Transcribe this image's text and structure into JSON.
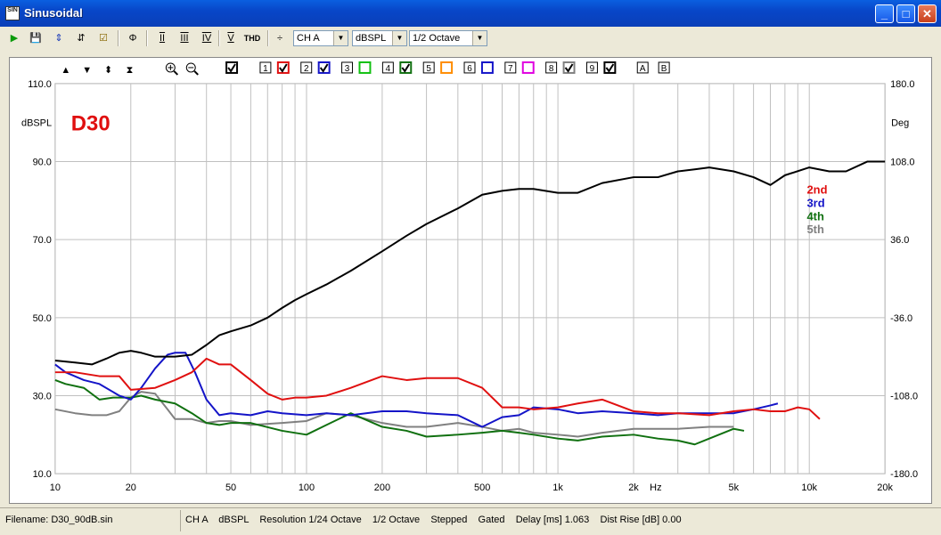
{
  "window": {
    "title": "Sinusoidal",
    "icon_text": "SIN"
  },
  "toolbar": {
    "thd_label": "THD",
    "combos": [
      {
        "value": "CH A"
      },
      {
        "value": "dBSPL"
      },
      {
        "value": "1/2 Octave"
      }
    ]
  },
  "plot": {
    "label": "D30",
    "left_unit": "dBSPL",
    "right_unit": "Deg",
    "x_unit": "Hz",
    "left_ticks": [
      "110.0",
      "90.0",
      "70.0",
      "50.0",
      "30.0",
      "10.0"
    ],
    "right_ticks": [
      "180.0",
      "108.0",
      "36.0",
      "-36.0",
      "-108.0",
      "-180.0"
    ],
    "x_ticks": [
      "10",
      "20",
      "50",
      "100",
      "200",
      "500",
      "1k",
      "2k",
      "5k",
      "10k",
      "20k"
    ],
    "legend": [
      "2nd",
      "3rd",
      "4th",
      "5th"
    ],
    "checkbox_numbers": [
      "1",
      "2",
      "3",
      "4",
      "5",
      "6",
      "7",
      "8",
      "9"
    ],
    "ab_buttons": [
      "A",
      "B"
    ]
  },
  "colors": {
    "fundamental": "#000000",
    "2nd": "#e01010",
    "3rd": "#1414c8",
    "4th": "#107010",
    "5th": "#808080",
    "label": "#e01010"
  },
  "chart_data": {
    "type": "line",
    "xscale": "log",
    "xlim": [
      10,
      20000
    ],
    "ylim": [
      10,
      110
    ],
    "xlabel": "Hz",
    "ylabel": "dBSPL",
    "series": [
      {
        "name": "fundamental",
        "x": [
          10,
          12,
          14,
          16,
          18,
          20,
          22,
          25,
          30,
          35,
          40,
          45,
          50,
          60,
          70,
          80,
          90,
          100,
          120,
          150,
          200,
          250,
          300,
          400,
          500,
          600,
          700,
          800,
          1000,
          1200,
          1500,
          2000,
          2500,
          3000,
          3500,
          4000,
          5000,
          6000,
          7000,
          8000,
          10000,
          12000,
          14000,
          17000,
          20000
        ],
        "y": [
          39,
          38.5,
          38,
          39.5,
          41,
          41.5,
          41,
          40,
          40,
          40.5,
          43,
          45.5,
          46.5,
          48,
          50,
          52.5,
          54.5,
          56,
          58.5,
          62,
          67,
          71,
          74,
          78,
          81.5,
          82.5,
          83,
          83,
          82,
          82,
          84.5,
          86,
          86,
          87.5,
          88,
          88.5,
          87.5,
          86,
          84,
          86.5,
          88.5,
          87.5,
          87.5,
          90,
          90
        ]
      },
      {
        "name": "2nd",
        "x": [
          10,
          12,
          15,
          18,
          20,
          25,
          30,
          35,
          40,
          45,
          50,
          60,
          70,
          80,
          90,
          100,
          120,
          150,
          200,
          250,
          300,
          400,
          500,
          600,
          700,
          800,
          1000,
          1200,
          1500,
          2000,
          2500,
          3000,
          4000,
          5000,
          6000,
          7000,
          8000,
          9000,
          10000,
          11000
        ],
        "y": [
          36,
          36,
          35,
          35,
          31.5,
          32,
          34,
          36,
          39.5,
          38,
          38,
          34,
          30.5,
          29,
          29.5,
          29.5,
          30,
          32,
          35,
          34,
          34.5,
          34.5,
          32,
          27,
          27,
          26.5,
          27,
          28,
          29,
          26,
          25.5,
          25.5,
          25,
          26,
          26.5,
          26,
          26,
          27,
          26.5,
          24
        ]
      },
      {
        "name": "3rd",
        "x": [
          10,
          11,
          13,
          15,
          18,
          20,
          22,
          25,
          28,
          30,
          33,
          36,
          40,
          45,
          50,
          60,
          70,
          80,
          100,
          120,
          150,
          200,
          250,
          300,
          400,
          500,
          600,
          700,
          800,
          1000,
          1200,
          1500,
          2000,
          2500,
          3000,
          4000,
          5000,
          6000,
          7000,
          7500
        ],
        "y": [
          38,
          36,
          34,
          33,
          30,
          29,
          32,
          37,
          40.5,
          41,
          41,
          36,
          29,
          25,
          25.5,
          25,
          26,
          25.5,
          25,
          25.5,
          25,
          26,
          26,
          25.5,
          25,
          22,
          24.5,
          25,
          27,
          26.5,
          25.5,
          26,
          25.5,
          25,
          25.5,
          25.5,
          25.5,
          26.5,
          27.5,
          28
        ]
      },
      {
        "name": "4th",
        "x": [
          10,
          11,
          13,
          15,
          17,
          20,
          22,
          25,
          30,
          35,
          40,
          45,
          50,
          60,
          80,
          100,
          120,
          150,
          200,
          250,
          300,
          400,
          500,
          600,
          700,
          800,
          1000,
          1200,
          1500,
          2000,
          2500,
          3000,
          3500,
          4000,
          5000,
          5500
        ],
        "y": [
          34,
          33,
          32,
          29,
          29.5,
          29.5,
          30,
          29,
          28,
          25.5,
          23,
          22.5,
          23,
          23,
          21,
          20,
          22.5,
          25.5,
          22,
          21,
          19.5,
          20,
          20.5,
          21,
          20.5,
          20,
          19,
          18.5,
          19.5,
          20,
          19,
          18.5,
          17.5,
          19,
          21.5,
          21
        ]
      },
      {
        "name": "5th",
        "x": [
          10,
          12,
          14,
          16,
          18,
          20,
          22,
          25,
          28,
          30,
          35,
          40,
          45,
          50,
          60,
          80,
          100,
          120,
          150,
          200,
          250,
          300,
          400,
          500,
          600,
          700,
          800,
          1000,
          1200,
          1500,
          2000,
          2500,
          3000,
          4000,
          5000
        ],
        "y": [
          26.5,
          25.5,
          25,
          25,
          26,
          29.5,
          31,
          30.5,
          26.5,
          24,
          24,
          23,
          23.5,
          23.5,
          22.5,
          23,
          23.5,
          25.5,
          25,
          23,
          22,
          22,
          23,
          22,
          21,
          21.5,
          20.5,
          20,
          19.5,
          20.5,
          21.5,
          21.5,
          21.5,
          22,
          22
        ]
      }
    ]
  },
  "status": {
    "filename": "Filename: D30_90dB.sin",
    "info": "CH A    dBSPL    Resolution 1/24 Octave    1/2 Octave    Stepped    Gated    Delay [ms] 1.063    Dist Rise [dB] 0.00"
  }
}
